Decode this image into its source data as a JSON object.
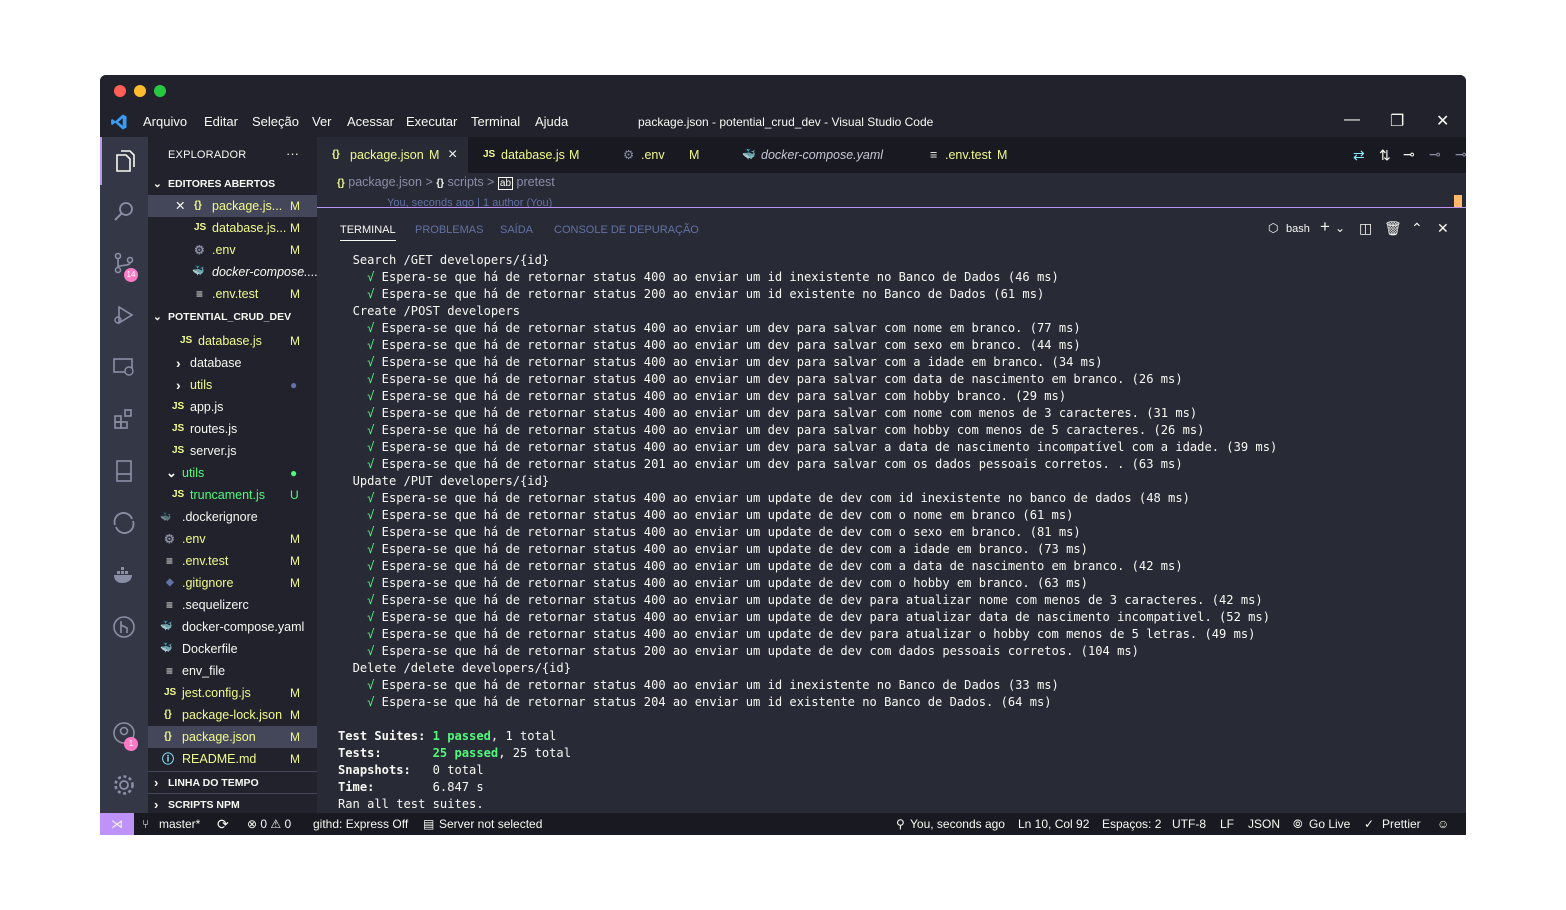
{
  "menu": [
    "Arquivo",
    "Editar",
    "Seleção",
    "Ver",
    "Acessar",
    "Executar",
    "Terminal",
    "Ajuda"
  ],
  "window_title": "package.json - potential_crud_dev - Visual Studio Code",
  "explorer": {
    "header": "EXPLORADOR",
    "more": "···",
    "open_editors_title": "EDITORES ABERTOS",
    "open_editors": [
      {
        "icon": "{}",
        "name": "package.js...",
        "mark": "M"
      },
      {
        "icon": "JS",
        "name": "database.js...",
        "mark": "M"
      },
      {
        "icon": "⚙",
        "name": ".env",
        "mark": "M"
      },
      {
        "icon": "🐳",
        "name": "docker-compose....",
        "mark": ""
      },
      {
        "icon": "≡",
        "name": ".env.test",
        "mark": "M"
      }
    ],
    "project_title": "POTENTIAL_CRUD_DEV",
    "files": [
      {
        "icon": "JS",
        "name": "database.js",
        "mark": "M",
        "indent": 2
      },
      {
        "icon": "›",
        "name": "database",
        "mark": "",
        "indent": 2
      },
      {
        "icon": "›",
        "name": "utils",
        "mark": "●",
        "indent": 2
      },
      {
        "icon": "JS",
        "name": "app.js",
        "mark": "",
        "indent": 1
      },
      {
        "icon": "JS",
        "name": "routes.js",
        "mark": "",
        "indent": 1
      },
      {
        "icon": "JS",
        "name": "server.js",
        "mark": "",
        "indent": 1
      },
      {
        "icon": "⌄",
        "name": "utils",
        "mark": "●",
        "indent": 1
      },
      {
        "icon": "JS",
        "name": "truncament.js",
        "mark": "U",
        "indent": 1
      },
      {
        "icon": "🐳",
        "name": ".dockerignore",
        "mark": "",
        "indent": 0
      },
      {
        "icon": "⚙",
        "name": ".env",
        "mark": "M",
        "indent": 0
      },
      {
        "icon": "≡",
        "name": ".env.test",
        "mark": "M",
        "indent": 0
      },
      {
        "icon": "◆",
        "name": ".gitignore",
        "mark": "M",
        "indent": 0
      },
      {
        "icon": "≡",
        "name": ".sequelizerc",
        "mark": "",
        "indent": 0
      },
      {
        "icon": "🐳",
        "name": "docker-compose.yaml",
        "mark": "",
        "indent": 0
      },
      {
        "icon": "🐳",
        "name": "Dockerfile",
        "mark": "",
        "indent": 0
      },
      {
        "icon": "≡",
        "name": "env_file",
        "mark": "",
        "indent": 0
      },
      {
        "icon": "JS",
        "name": "jest.config.js",
        "mark": "M",
        "indent": 0
      },
      {
        "icon": "{}",
        "name": "package-lock.json",
        "mark": "M",
        "indent": 0
      },
      {
        "icon": "{}",
        "name": "package.json",
        "mark": "M",
        "indent": 0
      },
      {
        "icon": "ⓘ",
        "name": "README.md",
        "mark": "M",
        "indent": 0
      }
    ],
    "timeline_title": "LINHA DO TEMPO",
    "npm_title": "SCRIPTS NPM"
  },
  "activity_badges": {
    "scm": "14",
    "accounts": "1"
  },
  "tabs": [
    {
      "icon": "{}",
      "label": "package.json",
      "mark": "M",
      "close": "×"
    },
    {
      "icon": "JS",
      "label": "database.js",
      "mark": "M",
      "close": ""
    },
    {
      "icon": "⚙",
      "label": ".env",
      "mark": "M",
      "close": ""
    },
    {
      "icon": "🐳",
      "label": "docker-compose.yaml",
      "mark": "",
      "close": ""
    },
    {
      "icon": "≡",
      "label": ".env.test",
      "mark": "M",
      "close": ""
    }
  ],
  "breadcrumb": {
    "file": "package.json",
    "sep1": ">",
    "key": "scripts",
    "sep2": ">",
    "leaf": "pretest"
  },
  "blame": "You, seconds ago | 1 author (You)",
  "panel_tabs": [
    "TERMINAL",
    "PROBLEMAS",
    "SAÍDA",
    "CONSOLE DE DEPURAÇÃO"
  ],
  "shell": "bash",
  "terminal_lines": [
    {
      "indent": "  ",
      "check": "",
      "text": "Search /GET developers/{id}"
    },
    {
      "indent": "    ",
      "check": "√",
      "text": " Espera-se que há de retornar status 400 ao enviar um id inexistente no Banco de Dados (46 ms)"
    },
    {
      "indent": "    ",
      "check": "√",
      "text": " Espera-se que há de retornar status 200 ao enviar um id existente no Banco de Dados (61 ms)"
    },
    {
      "indent": "  ",
      "check": "",
      "text": "Create /POST developers"
    },
    {
      "indent": "    ",
      "check": "√",
      "text": " Espera-se que há de retornar status 400 ao enviar um dev para salvar com nome em branco. (77 ms)"
    },
    {
      "indent": "    ",
      "check": "√",
      "text": " Espera-se que há de retornar status 400 ao enviar um dev para salvar com sexo em branco. (44 ms)"
    },
    {
      "indent": "    ",
      "check": "√",
      "text": " Espera-se que há de retornar status 400 ao enviar um dev para salvar com a idade em branco. (34 ms)"
    },
    {
      "indent": "    ",
      "check": "√",
      "text": " Espera-se que há de retornar status 400 ao enviar um dev para salvar com data de nascimento em branco. (26 ms)"
    },
    {
      "indent": "    ",
      "check": "√",
      "text": " Espera-se que há de retornar status 400 ao enviar um dev para salvar com hobby branco. (29 ms)"
    },
    {
      "indent": "    ",
      "check": "√",
      "text": " Espera-se que há de retornar status 400 ao enviar um dev para salvar com nome com menos de 3 caracteres. (31 ms)"
    },
    {
      "indent": "    ",
      "check": "√",
      "text": " Espera-se que há de retornar status 400 ao enviar um dev para salvar com hobby com menos de 5 caracteres. (26 ms)"
    },
    {
      "indent": "    ",
      "check": "√",
      "text": " Espera-se que há de retornar status 400 ao enviar um dev para salvar a data de nascimento incompatível com a idade. (39 ms)"
    },
    {
      "indent": "    ",
      "check": "√",
      "text": " Espera-se que há de retornar status 201 ao enviar um dev para salvar com os dados pessoais corretos. . (63 ms)"
    },
    {
      "indent": "  ",
      "check": "",
      "text": "Update /PUT developers/{id}"
    },
    {
      "indent": "    ",
      "check": "√",
      "text": " Espera-se que há de retornar status 400 ao enviar um update de dev com id inexistente no banco de dados (48 ms)"
    },
    {
      "indent": "    ",
      "check": "√",
      "text": " Espera-se que há de retornar status 400 ao enviar um update de dev com o nome em branco (61 ms)"
    },
    {
      "indent": "    ",
      "check": "√",
      "text": " Espera-se que há de retornar status 400 ao enviar um update de dev com o sexo em branco. (81 ms)"
    },
    {
      "indent": "    ",
      "check": "√",
      "text": " Espera-se que há de retornar status 400 ao enviar um update de dev com a idade em branco. (73 ms)"
    },
    {
      "indent": "    ",
      "check": "√",
      "text": " Espera-se que há de retornar status 400 ao enviar um update de dev com a data de nascimento em branco. (42 ms)"
    },
    {
      "indent": "    ",
      "check": "√",
      "text": " Espera-se que há de retornar status 400 ao enviar um update de dev com o hobby em branco. (63 ms)"
    },
    {
      "indent": "    ",
      "check": "√",
      "text": " Espera-se que há de retornar status 400 ao enviar um update de dev para atualizar nome com menos de 3 caracteres. (42 ms)"
    },
    {
      "indent": "    ",
      "check": "√",
      "text": " Espera-se que há de retornar status 400 ao enviar um update de dev para atualizar data de nascimento incompativel. (52 ms)"
    },
    {
      "indent": "    ",
      "check": "√",
      "text": " Espera-se que há de retornar status 400 ao enviar um update de dev para atualizar o hobby com menos de 5 letras. (49 ms)"
    },
    {
      "indent": "    ",
      "check": "√",
      "text": " Espera-se que há de retornar status 200 ao enviar um update de dev com dados pessoais corretos. (104 ms)"
    },
    {
      "indent": "  ",
      "check": "",
      "text": "Delete /delete developers/{id}"
    },
    {
      "indent": "    ",
      "check": "√",
      "text": " Espera-se que há de retornar status 400 ao enviar um id inexistente no Banco de Dados (33 ms)"
    },
    {
      "indent": "    ",
      "check": "√",
      "text": " Espera-se que há de retornar status 204 ao enviar um id existente no Banco de Dados. (64 ms)"
    }
  ],
  "summary": {
    "suites_label": "Test Suites: ",
    "suites_passed": "1 passed",
    "suites_rest": ", 1 total",
    "tests_label": "Tests:       ",
    "tests_passed": "25 passed",
    "tests_rest": ", 25 total",
    "snapshots": "Snapshots:   0 total",
    "time": "Time:        6.847 s",
    "ran": "Ran all test suites."
  },
  "status": {
    "branch": "master*",
    "sync": "⟳",
    "problems": "⊗ 0 ⚠ 0",
    "githd": "githd: Express Off",
    "server": "Server not selected",
    "blame": "You, seconds ago",
    "position": "Ln 10, Col 92",
    "spaces": "Espaços: 2",
    "encoding": "UTF-8",
    "eol": "LF",
    "lang": "JSON",
    "golive": "Go Live",
    "prettier": "Prettier"
  },
  "colors": {
    "accent": "#bd93f9",
    "green": "#50fa7b",
    "pink": "#ff79c6",
    "yellow": "#f1fa8c",
    "bg": "#282a36"
  }
}
